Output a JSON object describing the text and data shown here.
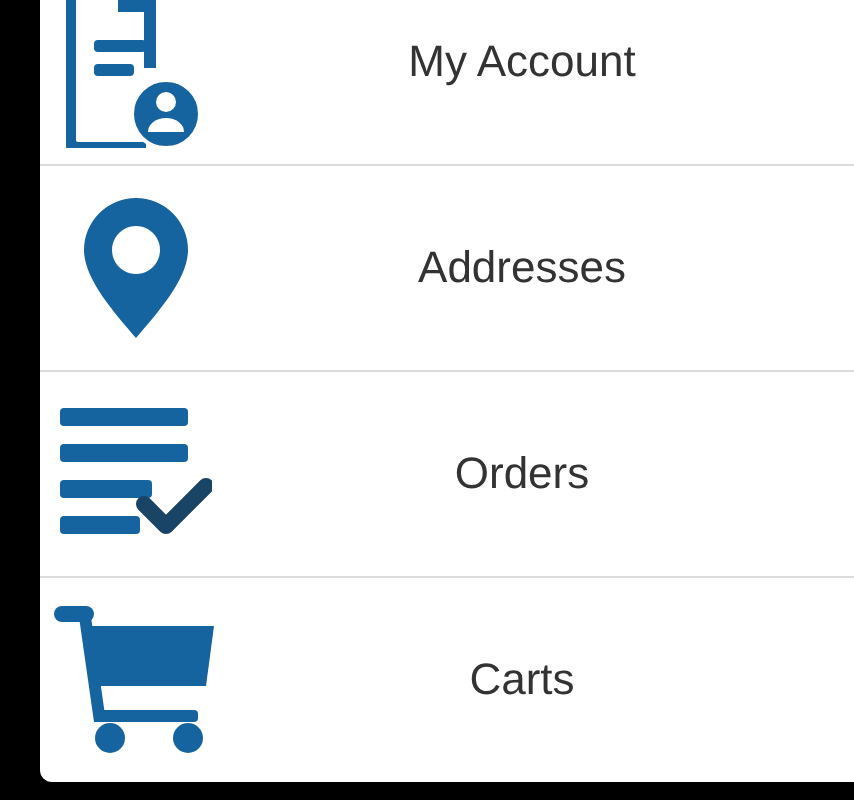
{
  "menu": {
    "items": [
      {
        "label": "My Account"
      },
      {
        "label": "Addresses"
      },
      {
        "label": "Orders"
      },
      {
        "label": "Carts"
      }
    ]
  }
}
